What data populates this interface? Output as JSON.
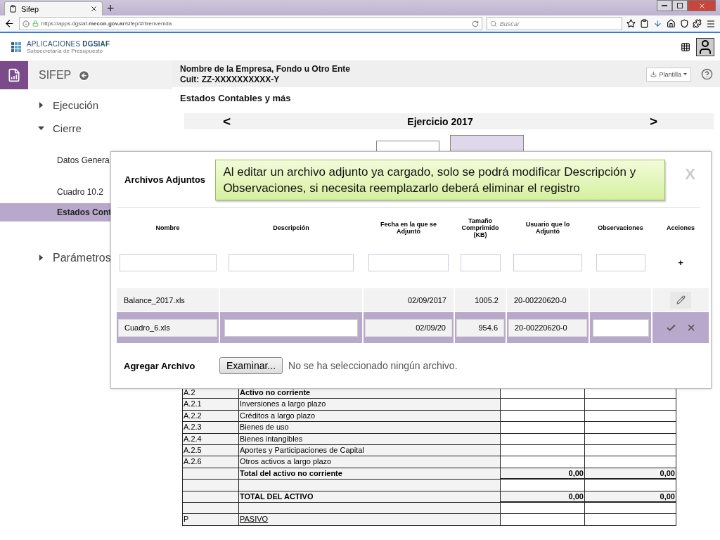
{
  "browser": {
    "tab_title": "Sifep",
    "new_tab": "+",
    "url": "https://apps.dgsiaf.**mecon.gov.ar**/sifep/#/bienvenida",
    "search": {
      "placeholder": "Buscar"
    }
  },
  "app_header": {
    "logo_title": "APLICACIONES **DGSIAF**",
    "logo_subtitle": "Subsecretaría de Presupuesto"
  },
  "sidebar": {
    "title": "SIFEP",
    "items": [
      {
        "label": "Ejecución",
        "expanded": false
      },
      {
        "label": "Cierre",
        "expanded": true,
        "children": [
          {
            "label": "Datos Genera",
            "selected": false
          },
          {
            "label": "Cuadro 10.2",
            "selected": false
          },
          {
            "label": "Estados Cont",
            "selected": true
          }
        ]
      },
      {
        "label": "Parámetros",
        "expanded": false
      }
    ]
  },
  "main": {
    "entity_name": "Nombre de la Empresa, Fondo u Otro Ente",
    "cuit": "Cuit: ZZ-XXXXXXXXXX-Y",
    "template_button": "Plantilla",
    "section_title": "Estados Contables y más",
    "year_label": "Ejercicio 2017",
    "prev": "<",
    "next": ">",
    "tabs": [
      {
        "selected": false
      },
      {
        "selected": true
      }
    ],
    "balance_rows": [
      {
        "kind": "header",
        "code": "A.2",
        "label": "Activo no corriente"
      },
      {
        "kind": "item",
        "code": "A.2.1",
        "label": "Inversiones a largo plazo"
      },
      {
        "kind": "item",
        "code": "A.2.2",
        "label": "Créditos a largo plazo"
      },
      {
        "kind": "item",
        "code": "A.2.3",
        "label": "Bienes de uso"
      },
      {
        "kind": "item",
        "code": "A.2.4",
        "label": "Bienes intangibles"
      },
      {
        "kind": "item",
        "code": "A.2.5",
        "label": "Aportes y Participaciones de Capital"
      },
      {
        "kind": "item",
        "code": "A.2.6",
        "label": "Otros activos a largo plazo"
      },
      {
        "kind": "total",
        "label": "Total del activo no corriente",
        "value_1": "0,00",
        "value_2": "0,00"
      },
      {
        "kind": "blank"
      },
      {
        "kind": "total",
        "label": "TOTAL DEL ACTIVO",
        "value_1": "0,00",
        "value_2": "0,00"
      },
      {
        "kind": "blank"
      },
      {
        "kind": "section",
        "code": "P",
        "label": "PASIVO"
      }
    ]
  },
  "modal": {
    "title": "Archivos Adjuntos",
    "notice": "Al editar un archivo adjunto ya cargado, solo se podrá modificar Descripción y Observaciones, si necesita reemplazarlo deberá eliminar el registro",
    "close": "X",
    "columns": [
      {
        "label": "Nombre",
        "filter": true
      },
      {
        "label": "Descripción",
        "filter": true
      },
      {
        "label": "Fecha en la que se Adjuntó",
        "filter": true
      },
      {
        "label": "Tamaño Comprimido (KB)",
        "filter": true
      },
      {
        "label": "Usuario que lo Adjuntó",
        "filter": true
      },
      {
        "label": "Observaciones",
        "filter": true
      },
      {
        "label": "Acciones",
        "filter": false
      }
    ],
    "add_symbol": "+",
    "rows": [
      {
        "kind": "view",
        "nombre": "Balance_2017.xls",
        "fecha": "02/09/2017",
        "tamano": "1005.2",
        "usuario": "20-00220620-0"
      },
      {
        "kind": "edit",
        "nombre": "Cuadro_6.xls",
        "fecha": "02/09/20",
        "tamano": "954.6",
        "usuario": "20-00220620-0"
      }
    ],
    "attach_label": "Agregar Archivo",
    "browse_button": "Examinar...",
    "no_file": "No se ha seleccionado ningún archivo."
  }
}
